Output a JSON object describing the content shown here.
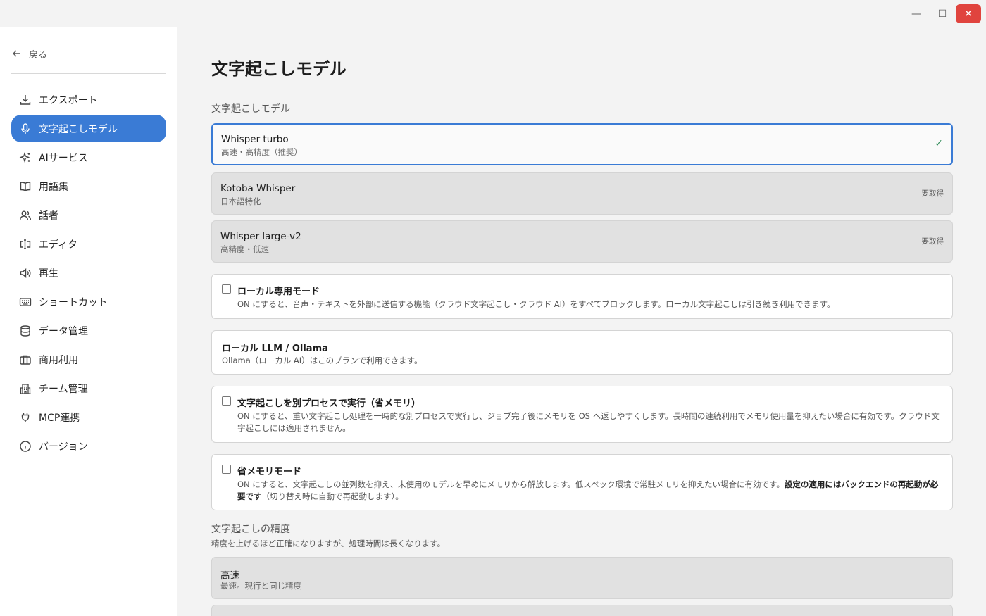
{
  "window": {
    "minimize_icon": "minimize-icon",
    "maximize_icon": "maximize-icon",
    "close_icon": "close-icon",
    "close_color": "#e0443e"
  },
  "sidebar": {
    "back_label": "戻る",
    "accent": "#3a7bd5",
    "items": [
      {
        "label": "エクスポート",
        "icon": "download-icon"
      },
      {
        "label": "文字起こしモデル",
        "icon": "microphone-icon",
        "active": true
      },
      {
        "label": "AIサービス",
        "icon": "sparkles-icon"
      },
      {
        "label": "用語集",
        "icon": "book-icon"
      },
      {
        "label": "話者",
        "icon": "users-icon"
      },
      {
        "label": "エディタ",
        "icon": "text-cursor-icon"
      },
      {
        "label": "再生",
        "icon": "speaker-icon"
      },
      {
        "label": "ショートカット",
        "icon": "keyboard-icon"
      },
      {
        "label": "データ管理",
        "icon": "database-icon"
      },
      {
        "label": "商用利用",
        "icon": "briefcase-icon"
      },
      {
        "label": "チーム管理",
        "icon": "building-icon"
      },
      {
        "label": "MCP連携",
        "icon": "plug-icon"
      },
      {
        "label": "バージョン",
        "icon": "info-icon"
      }
    ]
  },
  "main": {
    "title": "文字起こしモデル",
    "models_section_label": "文字起こしモデル",
    "models": [
      {
        "name": "Whisper turbo",
        "sub": "高速・高精度（推奨）",
        "selected": true,
        "status": "✓"
      },
      {
        "name": "Kotoba Whisper",
        "sub": "日本語特化",
        "status": "要取得"
      },
      {
        "name": "Whisper large-v2",
        "sub": "高精度・低速",
        "status": "要取得"
      }
    ],
    "local_only": {
      "title": "ローカル専用モード",
      "desc": "ON にすると、音声・テキストを外部に送信する機能（クラウド文字起こし・クラウド AI）をすべてブロックします。ローカル文字起こしは引き続き利用できます。",
      "checked": false
    },
    "local_llm": {
      "title": "ローカル LLM / Ollama",
      "desc": "Ollama（ローカル AI）はこのプランで利用できます。"
    },
    "separate_process": {
      "title": "文字起こしを別プロセスで実行（省メモリ）",
      "desc": "ON にすると、重い文字起こし処理を一時的な別プロセスで実行し、ジョブ完了後にメモリを OS へ返しやすくします。長時間の連続利用でメモリ使用量を抑えたい場合に有効です。クラウド文字起こしには適用されません。",
      "checked": false
    },
    "memory_saver": {
      "title": "省メモリモード",
      "desc_pre": "ON にすると、文字起こしの並列数を抑え、未使用のモデルを早めにメモリから解放します。低スペック環境で常駐メモリを抑えたい場合に有効です。",
      "desc_bold": "設定の適用にはバックエンドの再起動が必要です",
      "desc_post": "（切り替え時に自動で再起動します）。",
      "checked": false
    },
    "accuracy_section_label": "文字起こしの精度",
    "accuracy_section_desc": "精度を上げるほど正確になりますが、処理時間は長くなります。",
    "accuracy_options": [
      {
        "name": "高速",
        "sub": "最速。現行と同じ精度"
      }
    ]
  }
}
